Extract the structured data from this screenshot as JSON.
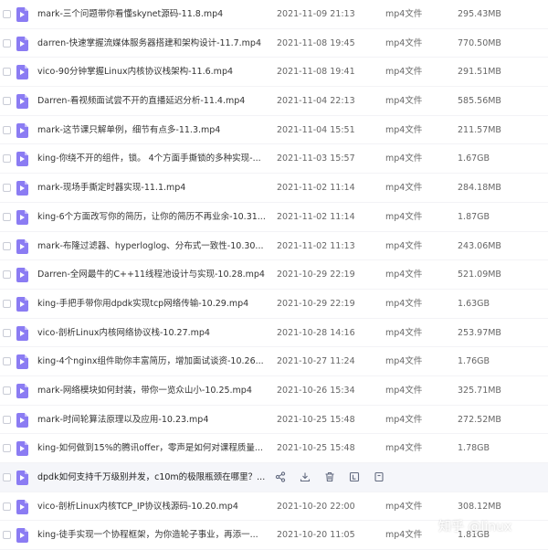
{
  "files": [
    {
      "name": "mark-三个问题带你看懂skynet源码-11.8.mp4",
      "date": "2021-11-09 21:13",
      "type": "mp4文件",
      "size": "295.43MB"
    },
    {
      "name": "darren-快速掌握流媒体服务器搭建和架构设计-11.7.mp4",
      "date": "2021-11-08 19:45",
      "type": "mp4文件",
      "size": "770.50MB"
    },
    {
      "name": "vico-90分钟掌握Linux内核协议栈架构-11.6.mp4",
      "date": "2021-11-08 19:41",
      "type": "mp4文件",
      "size": "291.51MB"
    },
    {
      "name": "Darren-看视频面试尝不开的直播延迟分析-11.4.mp4",
      "date": "2021-11-04 22:13",
      "type": "mp4文件",
      "size": "585.56MB"
    },
    {
      "name": "mark-这节课只解单例，细节有点多-11.3.mp4",
      "date": "2021-11-04 15:51",
      "type": "mp4文件",
      "size": "211.57MB"
    },
    {
      "name": "king-你绕不开的组件，锁。 4个方面手撕锁的多种实现-...",
      "date": "2021-11-03 15:57",
      "type": "mp4文件",
      "size": "1.67GB"
    },
    {
      "name": "mark-现场手撕定时器实现-11.1.mp4",
      "date": "2021-11-02 11:14",
      "type": "mp4文件",
      "size": "284.18MB"
    },
    {
      "name": "king-6个方面改写你的简历，让你的简历不再业余-10.31...",
      "date": "2021-11-02 11:14",
      "type": "mp4文件",
      "size": "1.87GB"
    },
    {
      "name": "mark-布隆过滤器、hyperloglog、分布式一致性-10.30...",
      "date": "2021-11-02 11:13",
      "type": "mp4文件",
      "size": "243.06MB"
    },
    {
      "name": "Darren-全网最牛的C++11线程池设计与实现-10.28.mp4",
      "date": "2021-10-29 22:19",
      "type": "mp4文件",
      "size": "521.09MB"
    },
    {
      "name": "king-手把手带你用dpdk实现tcp网络传输-10.29.mp4",
      "date": "2021-10-29 22:19",
      "type": "mp4文件",
      "size": "1.63GB"
    },
    {
      "name": "vico-剖析Linux内核网络协议栈-10.27.mp4",
      "date": "2021-10-28 14:16",
      "type": "mp4文件",
      "size": "253.97MB"
    },
    {
      "name": "king-4个nginx组件助你丰富简历，增加面试谈资-10.26...",
      "date": "2021-10-27 11:24",
      "type": "mp4文件",
      "size": "1.76GB"
    },
    {
      "name": "mark-网络模块如何封装，带你一览众山小-10.25.mp4",
      "date": "2021-10-26 15:34",
      "type": "mp4文件",
      "size": "325.71MB"
    },
    {
      "name": "mark-时间轮算法原理以及应用-10.23.mp4",
      "date": "2021-10-25 15:48",
      "type": "mp4文件",
      "size": "272.52MB"
    },
    {
      "name": "king-如何做到15%的腾讯offer，零声是如何对课程质量...",
      "date": "2021-10-25 15:48",
      "type": "mp4文件",
      "size": "1.78GB"
    },
    {
      "name": "dpdk如何支持千万级别并发，c10m的极限瓶颈在哪里？...",
      "date": "",
      "type": "",
      "size": "",
      "hover": true
    },
    {
      "name": "vico-剖析Linux内核TCP_IP协议栈源码-10.20.mp4",
      "date": "2021-10-20 22:00",
      "type": "mp4文件",
      "size": "308.12MB"
    },
    {
      "name": "king-徒手实现一个协程框架，为你造轮子事业，再添一...",
      "date": "2021-10-20 11:05",
      "type": "mp4文件",
      "size": "1.81GB"
    }
  ],
  "hover_actions": [
    "share-icon",
    "download-icon",
    "delete-icon",
    "rename-icon",
    "more-icon"
  ],
  "watermark": "知乎 @linux",
  "colors": {
    "file_icon": "#8b7cf3",
    "hover_row": "#f5f6fa",
    "text": "#333333",
    "meta_text": "#666666"
  }
}
